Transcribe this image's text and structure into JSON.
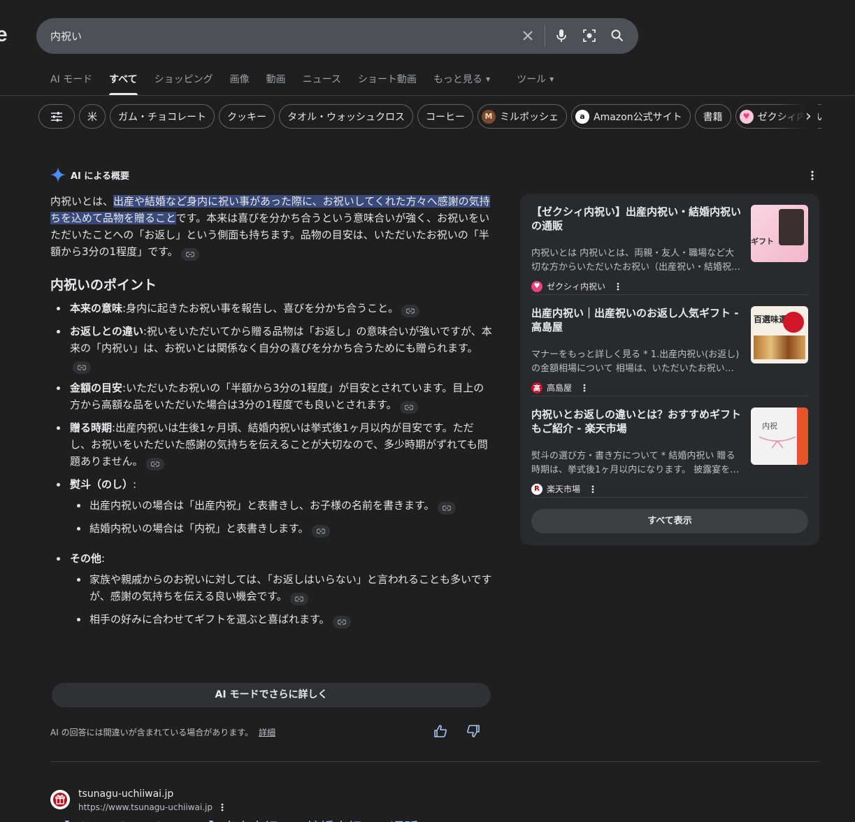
{
  "search": {
    "query": "内祝い"
  },
  "logo_fragment": "e",
  "tabs": [
    {
      "label": "AI モード",
      "active": false
    },
    {
      "label": "すべて",
      "active": true
    },
    {
      "label": "ショッピング",
      "active": false
    },
    {
      "label": "画像",
      "active": false
    },
    {
      "label": "動画",
      "active": false
    },
    {
      "label": "ニュース",
      "active": false
    },
    {
      "label": "ショート動画",
      "active": false
    },
    {
      "label": "もっと見る",
      "active": false,
      "caret": true
    },
    {
      "label": "ツール",
      "active": false,
      "caret": true
    }
  ],
  "chips": [
    {
      "label": "米"
    },
    {
      "label": "ガム・チョコレート"
    },
    {
      "label": "クッキー"
    },
    {
      "label": "タオル・ウォッシュクロス"
    },
    {
      "label": "コーヒー"
    },
    {
      "label": "ミルポッシェ",
      "icon": "milpochette-logo-icon"
    },
    {
      "label": "Amazon公式サイト",
      "icon": "amazon-logo-icon"
    },
    {
      "label": "書籍"
    },
    {
      "label": "ゼクシィ内祝い",
      "icon": "zexy-logo-icon"
    }
  ],
  "ai_overview": {
    "title": "AI による概要",
    "intro_prefix": "内祝いとは、",
    "intro_highlight": "出産や結婚など身内に祝い事があった際に、お祝いしてくれた方々へ感謝の気持ちを込めて品物を贈ること",
    "intro_rest": "です。本来は喜びを分かち合うという意味合いが強く、お祝いをいただいたことへの「お返し」という側面も持ちます。品物の目安は、いただいたお祝いの「半額から3分の1程度」です。",
    "points_heading": "内祝いのポイント",
    "points": [
      {
        "term": "本来の意味",
        "text": ":身内に起きたお祝い事を報告し、喜びを分かち合うこと。"
      },
      {
        "term": "お返しとの違い",
        "text": ":祝いをいただいてから贈る品物は「お返し」の意味合いが強いですが、本来の「内祝い」は、お祝いとは関係なく自分の喜びを分かち合うためにも贈られます。"
      },
      {
        "term": "金額の目安",
        "text": ":いただいたお祝いの「半額から3分の1程度」が目安とされています。目上の方から高額な品をいただいた場合は3分の1程度でも良いとされます。"
      },
      {
        "term": "贈る時期",
        "text": ":出産内祝いは生後1ヶ月頃、結婚内祝いは挙式後1ヶ月以内が目安です。ただし、お祝いをいただいた感謝の気持ちを伝えることが大切なので、多少時期がずれても問題ありません。"
      }
    ],
    "noshi": {
      "term": "熨斗（のし）",
      "colon": ":",
      "items": [
        "出産内祝いの場合は「出産内祝」と表書きし、お子様の名前を書きます。",
        "結婚内祝いの場合は「内祝」と表書きします。"
      ]
    },
    "other": {
      "term": "その他",
      "colon": ":",
      "items": [
        "家族や親戚からのお祝いに対しては、「お返しはいらない」と言われることも多いですが、感謝の気持ちを伝える良い機会です。",
        "相手の好みに合わせてギフトを選ぶと喜ばれます。"
      ]
    },
    "more_button": "AI モードでさらに詳しく",
    "disclaimer": "AI の回答には間違いが含まれている場合があります。",
    "disclaimer_link": "詳細"
  },
  "sources": [
    {
      "title": "【ゼクシィ内祝い】出産内祝い・結婚内祝いの通販",
      "snippet": "内祝いとは 内祝いとは、両親・友人・職場など大切な方からいただいたお祝い（出産祝い・結婚祝い）のお返しとして贈る品物です。",
      "site": "ゼクシィ内祝い",
      "favicon_color": "#e8437f",
      "image_label": "ギフト"
    },
    {
      "title": "出産内祝い｜出産祝いのお返し人気ギフト - 高島屋",
      "snippet": "マナーをもっと詳しく見る * 1.出産内祝い(お返し)の金額相場について 相場は、いただいたお祝いの半額程度です。",
      "site": "高島屋",
      "favicon_color": "#c8102e",
      "image_label": "百選味選り"
    },
    {
      "title": "内祝いとお返しの違いとは？おすすめギフトもご紹介 - 楽天市場",
      "snippet": "熨斗の選び方・書き方について * 結婚内祝い 贈る時期は、挙式後1ヶ月以内になります。 披露宴を行わない場合は…",
      "site": "楽天市場",
      "favicon_color": "#bf0000",
      "image_label": "内祝"
    }
  ],
  "show_all": "すべて表示",
  "result": {
    "domain": "tsunagu-uchiiwai.jp",
    "url": "https://www.tsunagu-uchiiwai.jp",
    "title": "【TSUNAGU UCHIIWAI】出産内祝い・結婚内祝いの通販"
  },
  "colors": {
    "background": "#1f1f1f",
    "highlight": "#394a7a",
    "link_blue": "#99c3ff",
    "sparkle_blue": "#4c8df6"
  }
}
